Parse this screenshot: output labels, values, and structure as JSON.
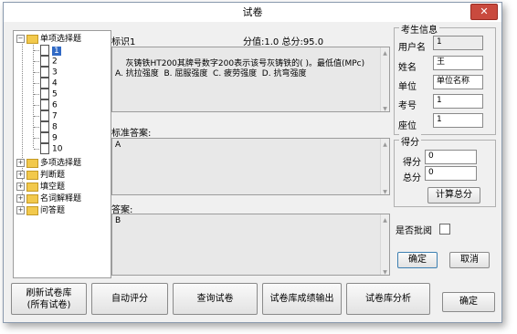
{
  "window": {
    "title": "试卷",
    "close_label": "✕"
  },
  "tree": {
    "single_choice": "单项选择题",
    "items": [
      "1",
      "2",
      "3",
      "4",
      "5",
      "6",
      "7",
      "8",
      "9",
      "10"
    ],
    "categories": [
      "多项选择题",
      "判断题",
      "填空题",
      "名词解释题",
      "问答题"
    ]
  },
  "question": {
    "id_label": "标识1",
    "score_label": "分值:1.0 总分:95.0",
    "text": "灰铸铁HT200其牌号数字200表示该号灰铸铁的( )。最低值(MPc)\nA. 抗拉强度  B. 屈服强度  C. 疲劳强度  D. 抗弯强度"
  },
  "standard_answer": {
    "label": "标准答案:",
    "value": "A"
  },
  "answer": {
    "label": "答案:",
    "value": "B"
  },
  "candidate": {
    "title": "考生信息",
    "username_label": "用户名",
    "username": "1",
    "name_label": "姓名",
    "name": "王",
    "unit_label": "单位",
    "unit": "单位名称",
    "exam_no_label": "考号",
    "exam_no": "1",
    "seat_label": "座位",
    "seat": "1"
  },
  "score": {
    "title": "得分",
    "score_label": "得分",
    "score": "0",
    "total_label": "总分",
    "total": "0",
    "calc_button": "计算总分"
  },
  "review": {
    "label": "是否批阅"
  },
  "buttons": {
    "ok": "确定",
    "cancel": "取消",
    "refresh_line1": "刷新试卷库",
    "refresh_line2": "(所有试卷)",
    "auto_grade": "自动评分",
    "query": "查询试卷",
    "export": "试卷库成绩输出",
    "analysis": "试卷库分析",
    "final_ok": "确定"
  }
}
